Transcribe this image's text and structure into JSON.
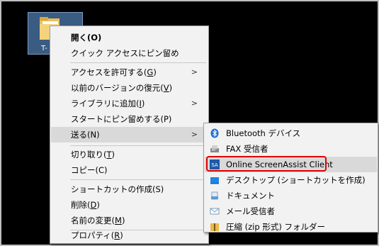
{
  "desktop": {
    "icon_label": "T-"
  },
  "context_menu": {
    "open": "開く",
    "open_key": "(O)",
    "pin_quick_access": "クイック アクセスにピン留め",
    "give_access": "アクセスを許可する(",
    "give_access_key": "G",
    "restore_prev": "以前のバージョンの復元(",
    "restore_prev_key": "V",
    "add_library": "ライブラリに追加(",
    "add_library_key": "I",
    "pin_start": "スタートにピン留めする(P)",
    "send_to": "送る(N)",
    "cut": "切り取り(",
    "cut_key": "T",
    "copy": "コピー(C)",
    "create_shortcut": "ショートカットの作成(S)",
    "delete": "削除(",
    "delete_key": "D",
    "rename": "名前の変更(",
    "rename_key": "M",
    "properties": "プロパティ(",
    "properties_key": "R",
    "close_paren": ")",
    "submenu_arrow": ">"
  },
  "sendto_menu": {
    "items": [
      {
        "label": "Bluetooth デバイス",
        "icon": "bluetooth-icon"
      },
      {
        "label": "FAX 受信者",
        "icon": "fax-icon"
      },
      {
        "label": "Online ScreenAssist Client",
        "icon": "screenassist-icon",
        "highlighted": true
      },
      {
        "label": "デスクトップ (ショートカットを作成)",
        "icon": "desktop-icon"
      },
      {
        "label": "ドキュメント",
        "icon": "documents-icon"
      },
      {
        "label": "メール受信者",
        "icon": "mail-icon"
      },
      {
        "label": "圧縮 (zip 形式) フォルダー",
        "icon": "zip-folder-icon"
      }
    ],
    "screenassist_icon_text": "SA"
  },
  "colors": {
    "highlight_box": "#e00000",
    "menu_bg": "#f2f2f2",
    "hover_bg": "#d9d9d9"
  }
}
